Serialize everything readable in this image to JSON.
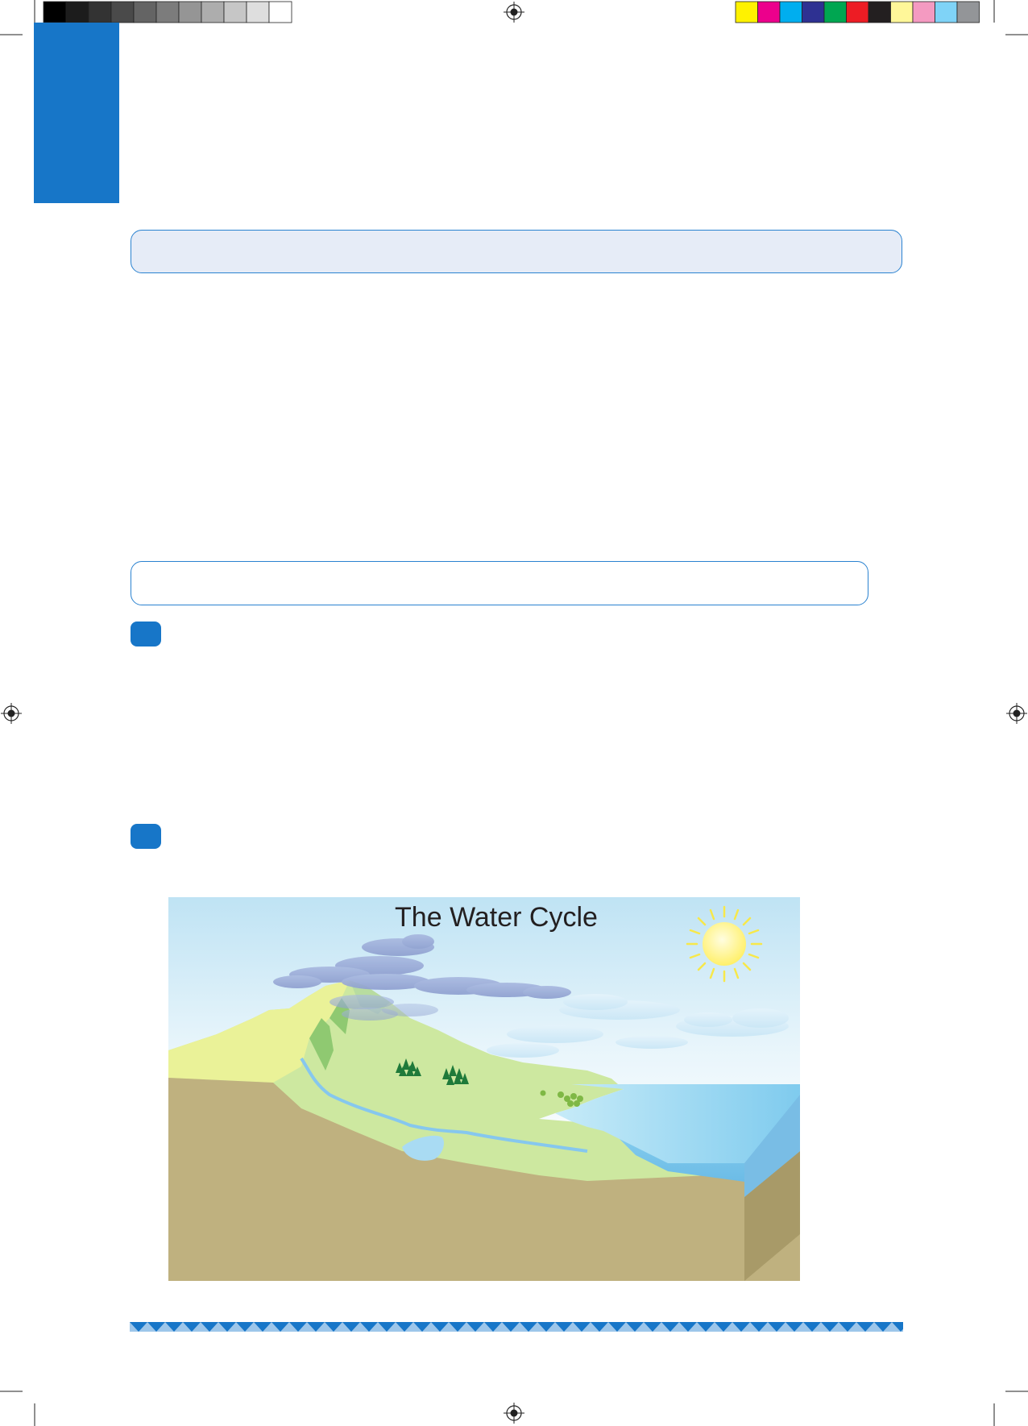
{
  "figure": {
    "title": "The Water Cycle"
  },
  "colors": {
    "accent_blue": "#1776c8",
    "box_fill": "#e6ecf7",
    "sky_top": "#bfe3f4",
    "land_green": "#cde8a0",
    "soil": "#bfb17f",
    "water": "#86cdee",
    "sun": "#fff27a"
  },
  "print_marks": {
    "gray_swatches": [
      "#000000",
      "#1c1c1c",
      "#333333",
      "#4a4a4a",
      "#646464",
      "#7c7c7c",
      "#959595",
      "#adadad",
      "#c6c6c6",
      "#dedede",
      "#ffffff"
    ],
    "color_swatches": [
      "#fff200",
      "#ec008c",
      "#00aeef",
      "#2e3192",
      "#00a651",
      "#ed1c24",
      "#231f20",
      "#fff799",
      "#f49ac1",
      "#7fd3f7",
      "#939598"
    ]
  }
}
